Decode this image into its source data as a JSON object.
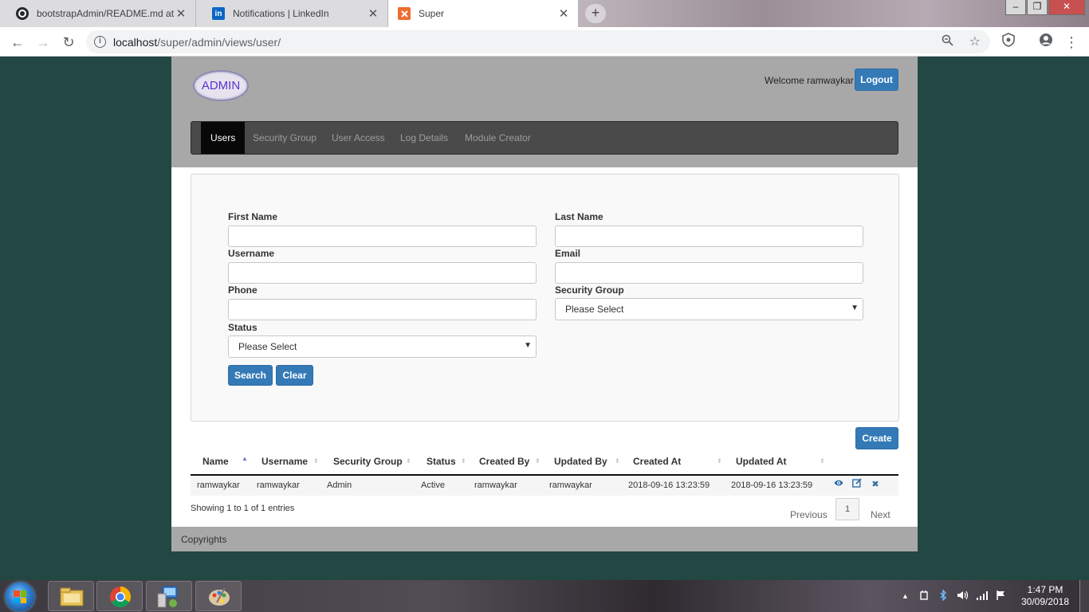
{
  "browser": {
    "tabs": [
      {
        "title": "bootstrapAdmin/README.md at",
        "icon": "github-icon"
      },
      {
        "title": "Notifications | LinkedIn",
        "icon": "linkedin-icon"
      },
      {
        "title": "Super",
        "icon": "xampp-icon",
        "active": true
      }
    ],
    "new_tab": "+",
    "url_host": "localhost",
    "url_path": "/super/admin/views/user/",
    "window_controls": {
      "minimize": "–",
      "maximize": "❐",
      "close": "✕"
    }
  },
  "header": {
    "logo": "ADMIN",
    "welcome": "Welcome ramwaykar",
    "logout": "Logout"
  },
  "nav": {
    "items": [
      "Users",
      "Security Group",
      "User Access",
      "Log Details",
      "Module Creator"
    ],
    "active": "Users"
  },
  "form": {
    "first_name_label": "First Name",
    "last_name_label": "Last Name",
    "username_label": "Username",
    "email_label": "Email",
    "phone_label": "Phone",
    "security_group_label": "Security Group",
    "security_group_value": "Please Select",
    "status_label": "Status",
    "status_value": "Please Select",
    "search_button": "Search",
    "clear_button": "Clear"
  },
  "create_button": "Create",
  "table": {
    "columns": [
      "Name",
      "Username",
      "Security Group",
      "Status",
      "Created By",
      "Updated By",
      "Created At",
      "Updated At"
    ],
    "rows": [
      [
        "ramwaykar",
        "ramwaykar",
        "Admin",
        "Active",
        "ramwaykar",
        "ramwaykar",
        "2018-09-16 13:23:59",
        "2018-09-16 13:23:59"
      ]
    ],
    "row_actions": [
      "view-icon",
      "edit-icon",
      "delete-icon"
    ],
    "summary": "Showing 1 to 1 of 1 entries",
    "pagination": {
      "previous": "Previous",
      "current": "1",
      "next": "Next"
    }
  },
  "footer": "Copyrights",
  "taskbar": {
    "time": "1:47 PM",
    "date": "30/09/2018",
    "apps": [
      "file-explorer-icon",
      "chrome-icon",
      "network-tool-icon",
      "paint-icon"
    ]
  },
  "colors": {
    "primary": "#337ab7",
    "nav_bg": "#4a4a4a",
    "header_bg": "#a8a8a8",
    "desktop_bg": "#234742"
  }
}
